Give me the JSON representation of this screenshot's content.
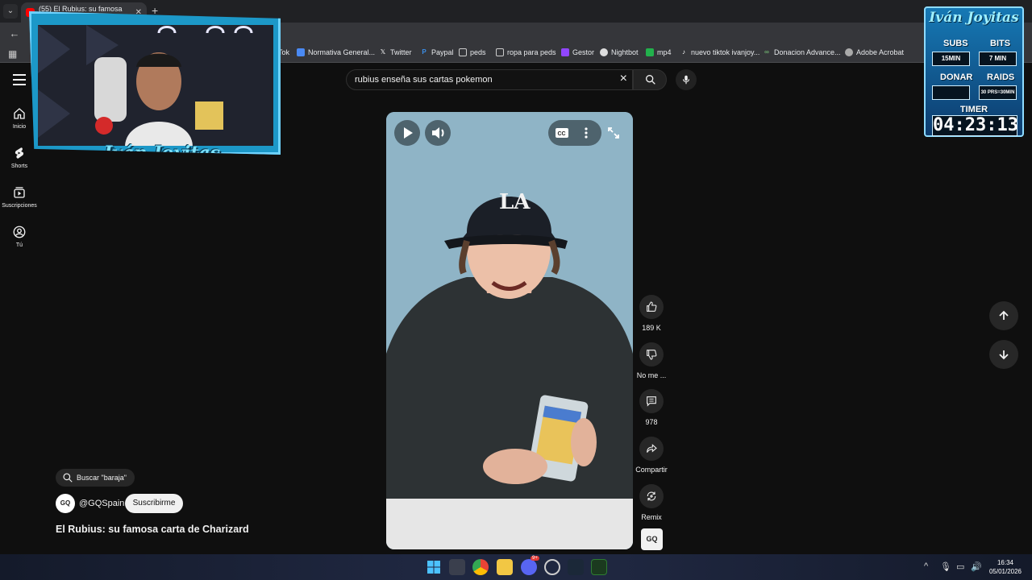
{
  "browser": {
    "tab_title": "(55) El Rubius: su famosa carta",
    "bookmarks": [
      {
        "label": "Tok",
        "icon": "tiktok-icon"
      },
      {
        "label": "Normativa General...",
        "icon": "document-icon"
      },
      {
        "label": "Twitter",
        "icon": "x-icon"
      },
      {
        "label": "Paypal",
        "icon": "paypal-icon"
      },
      {
        "label": "peds",
        "icon": "folder-icon"
      },
      {
        "label": "ropa para peds",
        "icon": "folder-icon"
      },
      {
        "label": "Gestor",
        "icon": "twitch-icon"
      },
      {
        "label": "Nightbot",
        "icon": "nightbot-icon"
      },
      {
        "label": "mp4",
        "icon": "green-app-icon"
      },
      {
        "label": "nuevo tiktok ivanjoy...",
        "icon": "tiktok-icon"
      },
      {
        "label": "Donacion Advance...",
        "icon": "link-icon"
      },
      {
        "label": "Adobe Acrobat",
        "icon": "globe-icon"
      }
    ]
  },
  "youtube": {
    "sidebar": [
      {
        "label": "Inicio",
        "icon": "home-icon"
      },
      {
        "label": "Shorts",
        "icon": "shorts-icon"
      },
      {
        "label": "Suscripciones",
        "icon": "subscriptions-icon"
      },
      {
        "label": "Tú",
        "icon": "user-icon"
      }
    ],
    "search": {
      "query": "rubius enseña sus cartas pokemon"
    },
    "actions": {
      "likes": "189 K",
      "dislike": "No me ...",
      "comments": "978",
      "share": "Compartir",
      "remix": "Remix"
    },
    "search_chip": "Buscar \"baraja\"",
    "channel": {
      "avatar": "GQ",
      "handle": "@GQSpain",
      "subscribe": "Suscribirme"
    },
    "video_title": "El Rubius: su famosa carta de Charizard",
    "gq_badge": "GQ"
  },
  "stream": {
    "cam_name": "Iván Joyitas",
    "overlay": {
      "title": "Iván Joyitas",
      "subs_label": "SUBS",
      "subs_value": "15MIN",
      "bits_label": "BITS",
      "bits_value": "7 MIN",
      "donar_label": "DONAR",
      "donar_value": "",
      "raids_label": "RAIDS",
      "raids_value": "30 PRS=30MIN",
      "timer_label": "TIMER",
      "timer_value": "04:23:13"
    }
  },
  "taskbar": {
    "time": "16:34",
    "date": "05/01/2026",
    "discord_badge": "9+"
  }
}
